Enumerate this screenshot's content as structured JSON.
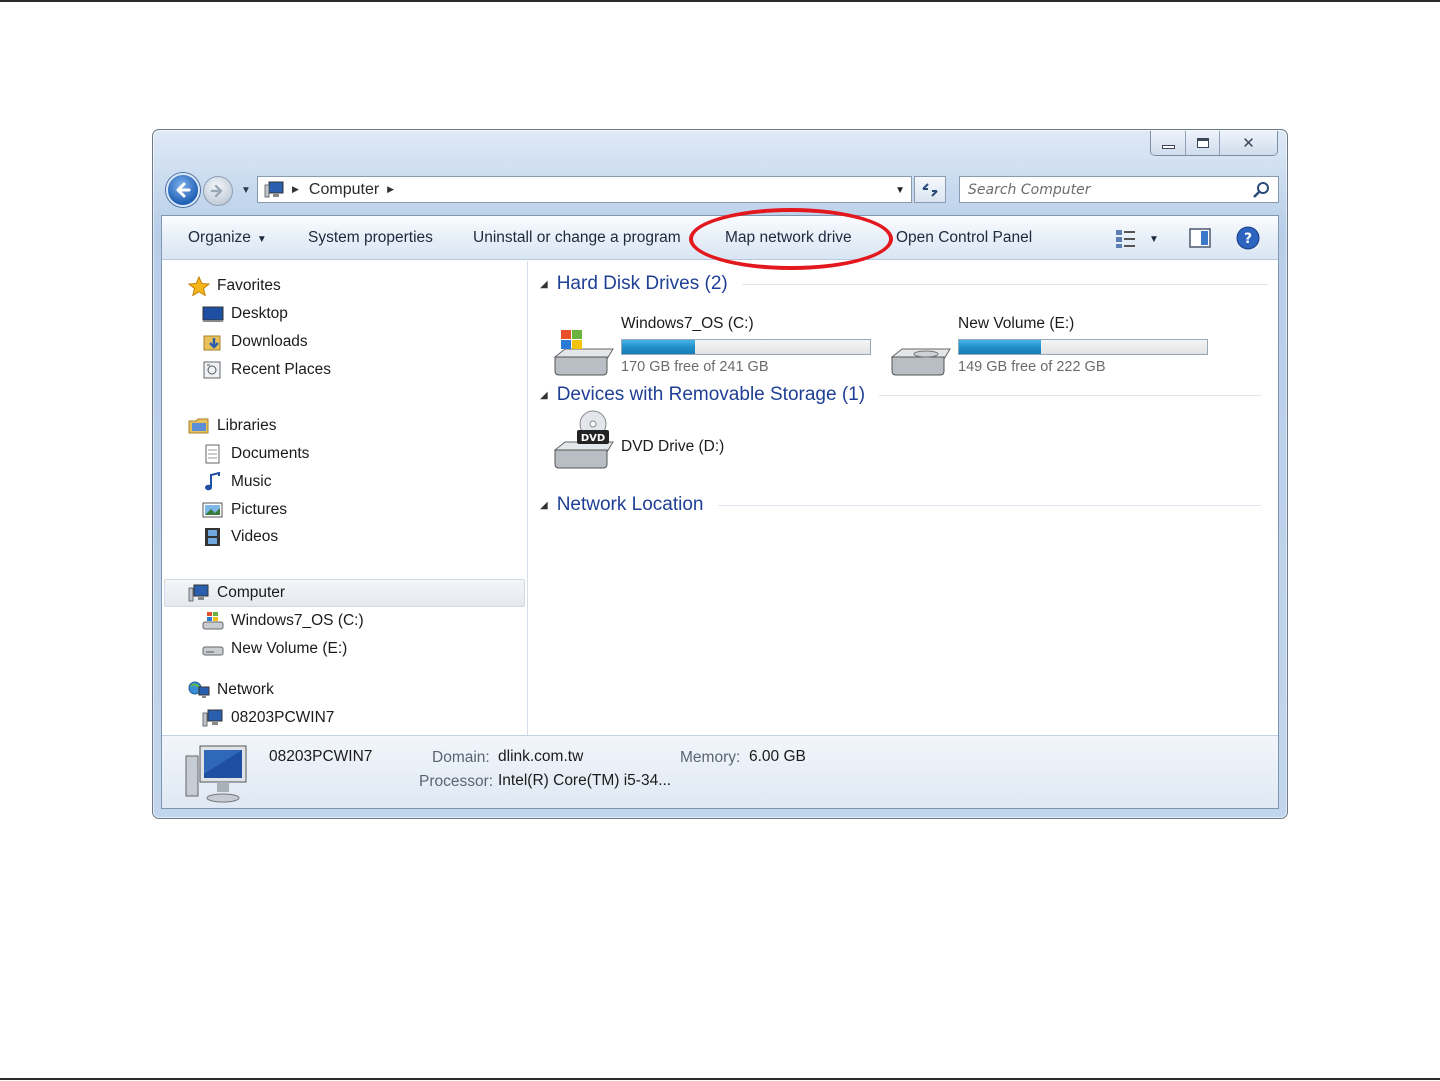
{
  "window": {
    "caption": {
      "minimize_icon": "minimize-icon",
      "maximize_icon": "maximize-icon",
      "close_icon": "close-icon"
    }
  },
  "address": {
    "breadcrumb": [
      "Computer"
    ],
    "search_placeholder": "Search Computer"
  },
  "toolbar": {
    "organize": "Organize",
    "system_properties": "System properties",
    "uninstall": "Uninstall or change a program",
    "map_network_drive": "Map network drive",
    "open_control_panel": "Open Control Panel",
    "highlight_color": "#e3171e"
  },
  "nav": {
    "favorites": {
      "label": "Favorites",
      "items": [
        "Desktop",
        "Downloads",
        "Recent Places"
      ]
    },
    "libraries": {
      "label": "Libraries",
      "items": [
        "Documents",
        "Music",
        "Pictures",
        "Videos"
      ]
    },
    "computer": {
      "label": "Computer",
      "items": [
        "Windows7_OS (C:)",
        "New Volume (E:)"
      ]
    },
    "network": {
      "label": "Network",
      "items": [
        "08203PCWIN7"
      ]
    }
  },
  "content": {
    "groups": {
      "hard_disks": "Hard Disk Drives (2)",
      "removable": "Devices with Removable Storage (1)",
      "network": "Network Location"
    },
    "drives": [
      {
        "name": "Windows7_OS (C:)",
        "free_text": "170 GB free of 241 GB",
        "used_fraction": 0.295
      },
      {
        "name": "New Volume (E:)",
        "free_text": "149 GB free of 222 GB",
        "used_fraction": 0.329
      }
    ],
    "removable": [
      {
        "name": "DVD Drive (D:)",
        "badge": "DVD"
      }
    ]
  },
  "details": {
    "computer_name": "08203PCWIN7",
    "domain_label": "Domain:",
    "domain_value": "dlink.com.tw",
    "memory_label": "Memory:",
    "memory_value": "6.00 GB",
    "processor_label": "Processor:",
    "processor_value": "Intel(R) Core(TM) i5-34..."
  },
  "colors": {
    "accent": "#1f3f95",
    "bar_fill": "#1f8cc7",
    "window_frame": "#c7d9ee"
  }
}
